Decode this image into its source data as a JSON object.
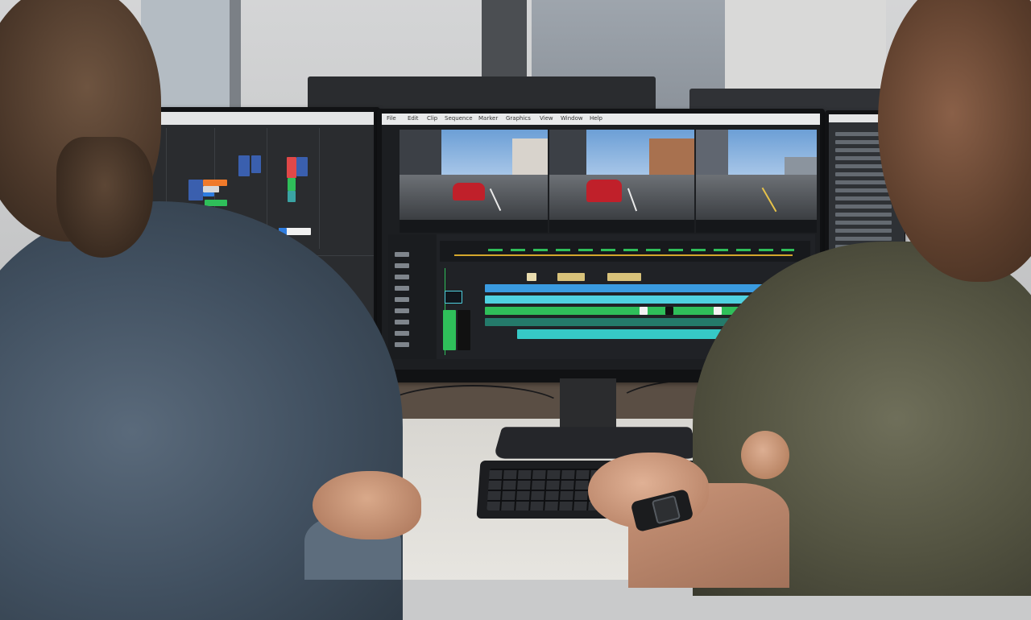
{
  "scene": {
    "description_tags": [
      "office",
      "two-people",
      "video-editing",
      "multi-monitor"
    ]
  },
  "center_monitor": {
    "app_menu": [
      "File",
      "Edit",
      "Clip",
      "Sequence",
      "Marker",
      "Graphics",
      "View",
      "Window",
      "Help"
    ],
    "viewers": [
      "source-viewer",
      "program-viewer",
      "reference-viewer"
    ]
  },
  "colors": {
    "timeline_teal": "#36c9c6",
    "timeline_blue": "#3a9be0",
    "timeline_green": "#2fbf5a",
    "timeline_yellow": "#d8c27a",
    "left_accent_blue": "#2f7de0",
    "left_accent_orange": "#f07a2a"
  }
}
